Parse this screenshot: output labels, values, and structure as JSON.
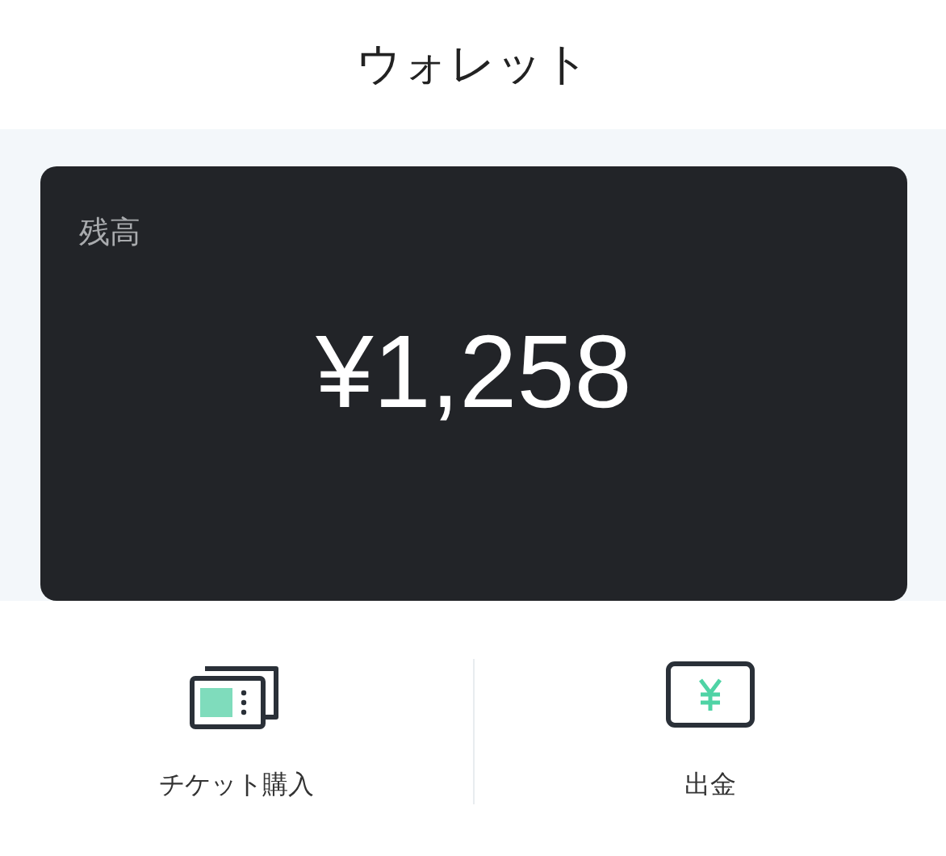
{
  "header": {
    "title": "ウォレット"
  },
  "balance": {
    "label": "残高",
    "amount": "¥1,258"
  },
  "actions": [
    {
      "kind": "ticket",
      "label": "チケット購入"
    },
    {
      "kind": "withdraw",
      "label": "出金"
    }
  ]
}
